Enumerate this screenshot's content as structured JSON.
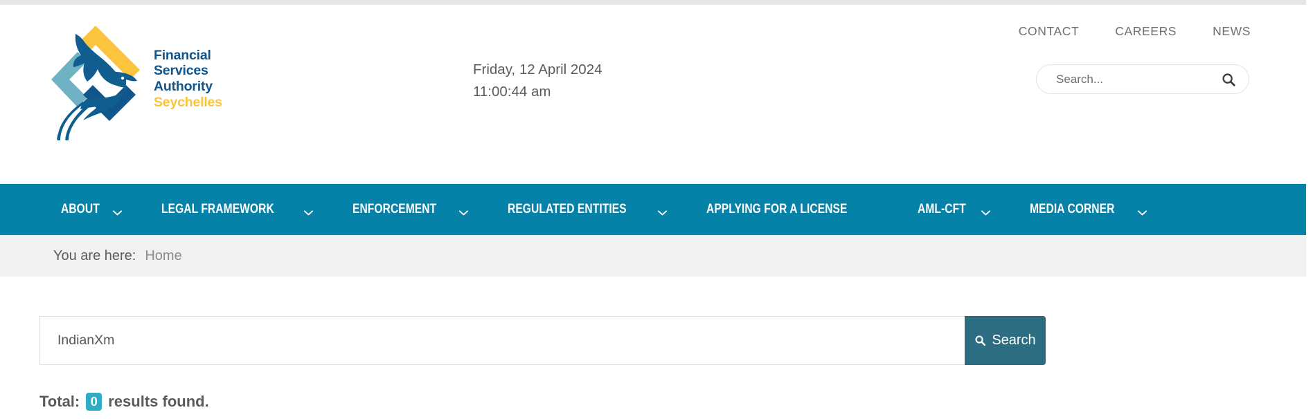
{
  "site": {
    "logo_alt": "Financial Services Authority Seychelles",
    "logo_lines": [
      {
        "text": "Financial",
        "color": "#10558c"
      },
      {
        "text": "Services",
        "color": "#10558c"
      },
      {
        "text": "Authority",
        "color": "#10558c"
      },
      {
        "text": "Seychelles",
        "color": "#fcc43e"
      }
    ]
  },
  "header": {
    "date": "Friday, 12 April 2024",
    "time": "11:00:44 am",
    "utility_links": [
      "CONTACT",
      "CAREERS",
      "NEWS"
    ],
    "search": {
      "placeholder": "Search...",
      "value": "",
      "icon": "search-icon"
    }
  },
  "mainnav": {
    "background": "#0681a8",
    "items": [
      {
        "label": "ABOUT",
        "has_dropdown": true
      },
      {
        "label": "LEGAL FRAMEWORK",
        "has_dropdown": true
      },
      {
        "label": "ENFORCEMENT",
        "has_dropdown": true
      },
      {
        "label": "REGULATED ENTITIES",
        "has_dropdown": true
      },
      {
        "label": "APPLYING FOR A LICENSE",
        "has_dropdown": false
      },
      {
        "label": "AML-CFT",
        "has_dropdown": true
      },
      {
        "label": "MEDIA CORNER",
        "has_dropdown": true
      }
    ]
  },
  "breadcrumb": {
    "prefix": "You are here:",
    "current": "Home"
  },
  "main": {
    "search": {
      "value": "IndianXm",
      "placeholder": "",
      "button_label": "Search",
      "button_icon": "search-icon",
      "button_color": "#2c6d81"
    },
    "results": {
      "prefix": "Total:",
      "count": "0",
      "suffix": "results found.",
      "badge_color": "#2eadc4"
    }
  }
}
